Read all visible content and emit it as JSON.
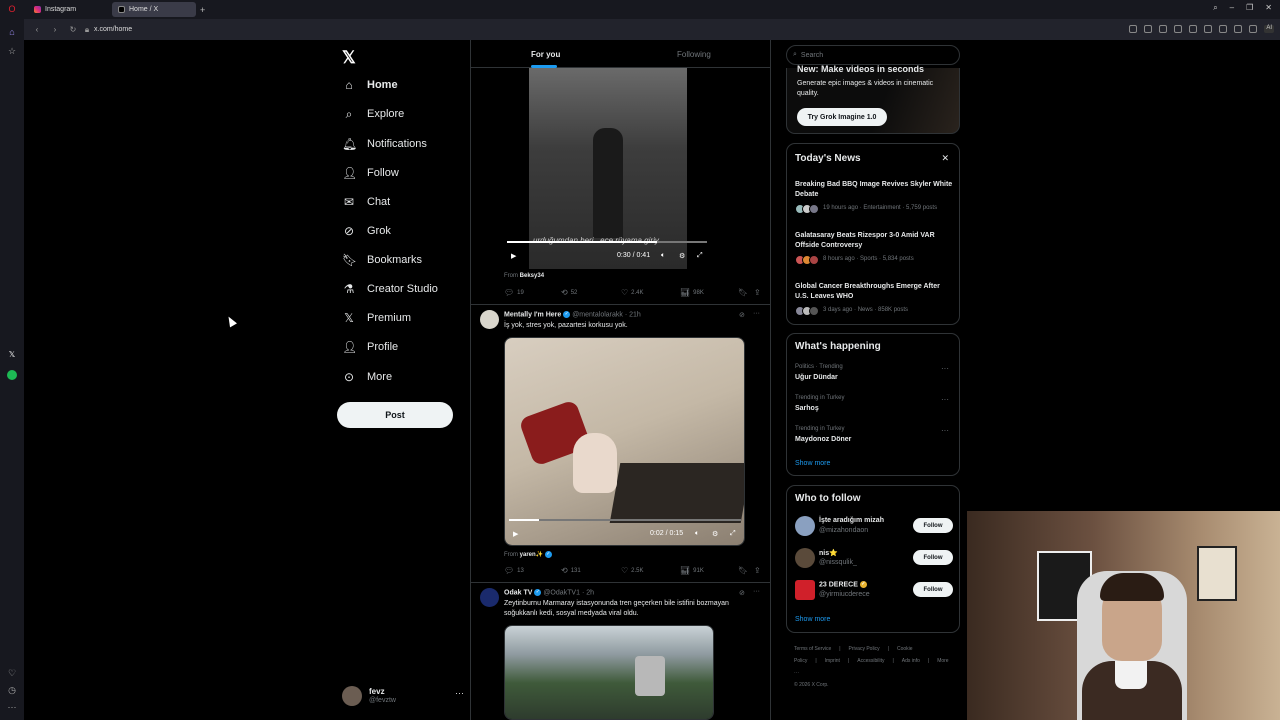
{
  "browser": {
    "tabs": [
      {
        "title": "Instagram",
        "active": false
      },
      {
        "title": "Home / X",
        "active": true
      }
    ],
    "new_tab_icon": "+",
    "url": "x.com/home"
  },
  "nav": {
    "items": [
      {
        "label": "Home",
        "icon": "home-icon",
        "bold": true
      },
      {
        "label": "Explore",
        "icon": "search-icon"
      },
      {
        "label": "Notifications",
        "icon": "bell-icon"
      },
      {
        "label": "Follow",
        "icon": "person-add-icon"
      },
      {
        "label": "Chat",
        "icon": "mail-icon"
      },
      {
        "label": "Grok",
        "icon": "grok-icon"
      },
      {
        "label": "Bookmarks",
        "icon": "bookmark-icon"
      },
      {
        "label": "Creator Studio",
        "icon": "creator-icon"
      },
      {
        "label": "Premium",
        "icon": "x-icon"
      },
      {
        "label": "Profile",
        "icon": "person-icon"
      },
      {
        "label": "More",
        "icon": "more-circle-icon"
      }
    ],
    "post_label": "Post",
    "account": {
      "name": "fevz",
      "handle": "@fevztw"
    }
  },
  "feed": {
    "tabs": [
      "For you",
      "Following"
    ],
    "video1": {
      "caption": "urduğumdan beri   ece rüyama giriy",
      "time": "0:30 / 0:41",
      "from_label": "From",
      "from_name": "Beksy34"
    },
    "post1_actions": {
      "replies": "19",
      "reposts": "52",
      "likes": "2.4K",
      "views": "98K"
    },
    "post2": {
      "name": "Mentally I'm Here",
      "handle": "@mentalolarakk",
      "time": "21h",
      "text": "İş yok, stres yok, pazartesi korkusu yok.",
      "video_time": "0:02 / 0:15",
      "from_label": "From",
      "from_name": "yaren✨",
      "replies": "13",
      "reposts": "131",
      "likes": "2.5K",
      "views": "91K"
    },
    "post3": {
      "name": "Odak TV",
      "handle": "@OdakTV1",
      "time": "2h",
      "text": "Zeytinburnu Marmaray istasyonunda tren geçerken bile istifini bozmayan soğukkanlı kedi, sosyal medyada viral oldu."
    }
  },
  "right": {
    "search_placeholder": "Search",
    "grok": {
      "title": "New: Make videos in seconds",
      "sub": "Generate epic images & videos in cinematic quality.",
      "button": "Try Grok Imagine 1.0"
    },
    "news": {
      "title": "Today's News",
      "items": [
        {
          "title": "Breaking Bad BBQ Image Revives Skyler White Debate",
          "meta": "19 hours ago · Entertainment · 5,759 posts"
        },
        {
          "title": "Galatasaray Beats Rizespor 3-0 Amid VAR Offside Controversy",
          "meta": "8 hours ago · Sports · 5,834 posts"
        },
        {
          "title": "Global Cancer Breakthroughs Emerge After U.S. Leaves WHO",
          "meta": "3 days ago · News · 858K posts"
        }
      ]
    },
    "happening": {
      "title": "What's happening",
      "items": [
        {
          "category": "Politics · Trending",
          "name": "Uğur Dündar"
        },
        {
          "category": "Trending in Turkey",
          "name": "Sarhoş"
        },
        {
          "category": "Trending in Turkey",
          "name": "Maydonoz Döner"
        }
      ],
      "show_more": "Show more"
    },
    "wtf": {
      "title": "Who to follow",
      "items": [
        {
          "name": "İşte aradığım mizah",
          "handle": "@mizahondaon",
          "button": "Follow"
        },
        {
          "name": "nis⭐",
          "handle": "@nissqulik_",
          "button": "Follow"
        },
        {
          "name": "23 DERECE",
          "handle": "@yirmiucderece",
          "button": "Follow"
        }
      ],
      "show_more": "Show more"
    },
    "footer": {
      "links": [
        "Terms of Service",
        "|",
        "Privacy Policy",
        "|",
        "Cookie Policy",
        "|",
        "Imprint",
        "|",
        "Accessibility",
        "|",
        "Ads info",
        "|",
        "More ···"
      ],
      "copyright": "© 2026 X Corp."
    }
  },
  "colors": {
    "accent": "#1d9bf0",
    "background": "#000000",
    "border": "#2f3336",
    "muted": "#71767b"
  }
}
